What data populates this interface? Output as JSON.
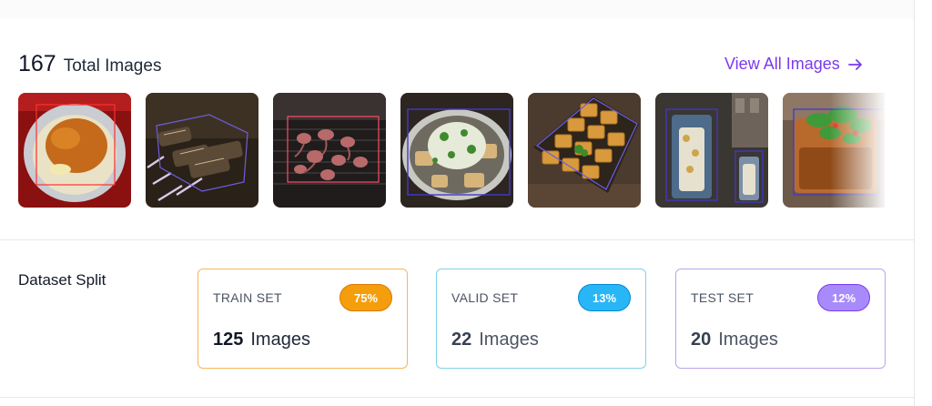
{
  "header": {
    "total_count": "167",
    "total_label": "Total Images",
    "view_all_label": "View All Images"
  },
  "thumbnails": [
    {
      "subject": "omelette-on-plate"
    },
    {
      "subject": "grilled-skewers"
    },
    {
      "subject": "grilled-squid"
    },
    {
      "subject": "tofu-salad-bowl"
    },
    {
      "subject": "fried-tofu-tray"
    },
    {
      "subject": "sausage-sticks"
    },
    {
      "subject": "tofu-with-greens"
    }
  ],
  "split": {
    "title": "Dataset Split",
    "cards": [
      {
        "name": "TRAIN SET",
        "percent": "75%",
        "count": "125",
        "unit": "Images",
        "color": "#f59e0b"
      },
      {
        "name": "VALID SET",
        "percent": "13%",
        "count": "22",
        "unit": "Images",
        "color": "#29b6f6"
      },
      {
        "name": "TEST SET",
        "percent": "12%",
        "count": "20",
        "unit": "Images",
        "color": "#a78bfa"
      }
    ]
  },
  "colors": {
    "accent": "#7c3aed",
    "annotation_box": "#4338ca"
  }
}
